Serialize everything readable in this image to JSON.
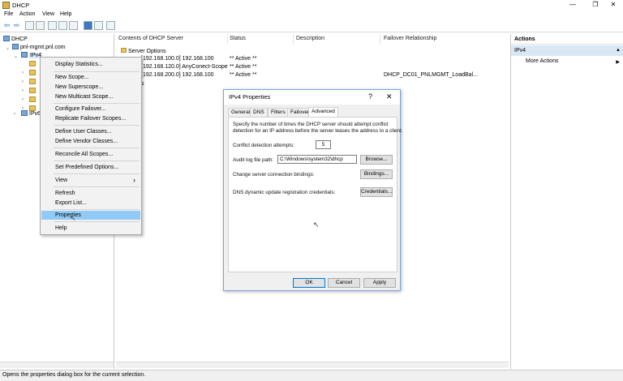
{
  "window": {
    "title": "DHCP",
    "minimize": "—",
    "maximize": "❐",
    "close": "✕"
  },
  "menu": [
    "File",
    "Action",
    "View",
    "Help"
  ],
  "tree": {
    "root": "DHCP",
    "server": "pnl-mgmt.pnl.com",
    "ipv4": "IPv4",
    "ipv6": "IPv6"
  },
  "list": {
    "columns": [
      "Contents of DHCP Server",
      "Status",
      "Description",
      "Failover Relationship"
    ],
    "rows": [
      {
        "name": "Server Options",
        "status": "",
        "failover": ""
      },
      {
        "name": "[192.168.100.0] 192.168.100",
        "status": "** Active **",
        "failover": ""
      },
      {
        "name": "[192.168.120.0] AnyConect-Scope",
        "status": "** Active **",
        "failover": ""
      },
      {
        "name": "[192.168.200.0] 192.168.100",
        "status": "** Active **",
        "failover": "DHCP_DC01_PNLMGMT_LoadBal..."
      }
    ],
    "row4_tail": "s"
  },
  "actions": {
    "header": "Actions",
    "subheader": "IPv4",
    "more": "More Actions",
    "arrow_up": "▲",
    "arrow_right": "▶"
  },
  "context_menu": {
    "items": [
      "Display Statistics...",
      "New Scope...",
      "New Superscope...",
      "New Multicast Scope...",
      "Configure Failover...",
      "Replicate Failover Scopes...",
      "Define User Classes...",
      "Define Vendor Classes...",
      "Reconcile All Scopes...",
      "Set Predefined Options...",
      "View",
      "Refresh",
      "Export List...",
      "Properties",
      "Help"
    ],
    "submenu_arrow": "›"
  },
  "dialog": {
    "title": "IPv4 Properties",
    "help": "?",
    "close": "✕",
    "tabs": [
      "General",
      "DNS",
      "Filters",
      "Failover",
      "Advanced"
    ],
    "description_line1": "Specify the number of times the DHCP server should attempt conflict",
    "description_line2": "detection for an IP address before the server leases the address to a client.",
    "conflict_label": "Conflict detection attempts:",
    "conflict_value": "5",
    "audit_label": "Audit log file path:",
    "audit_value": "C:\\Windows\\system32\\dhcp",
    "browse": "Browse...",
    "bindings_label": "Change server connection bindings:",
    "bindings": "Bindings...",
    "dns_label": "DNS dynamic update registration credentials:",
    "credentials": "Credentials...",
    "ok": "OK",
    "cancel": "Cancel",
    "apply": "Apply"
  },
  "status_text": "Opens the properties dialog box for the current selection."
}
